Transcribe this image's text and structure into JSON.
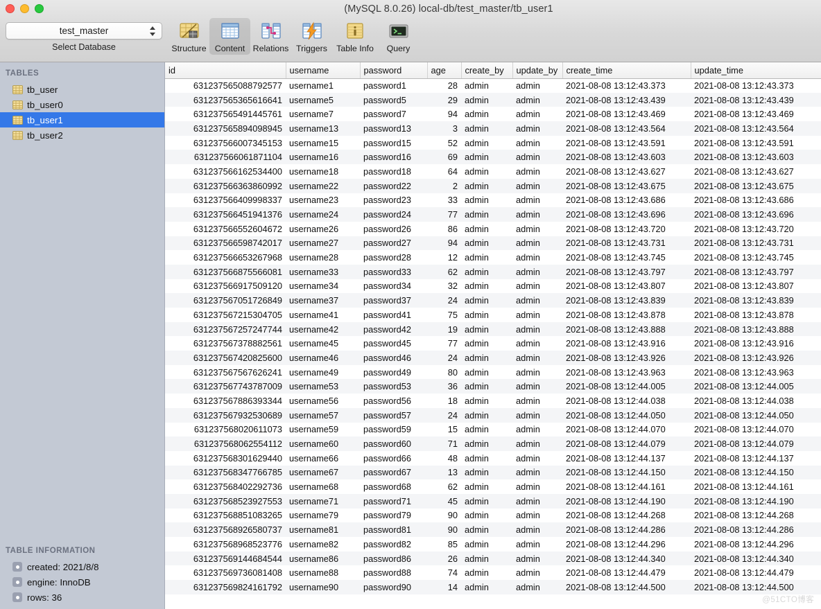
{
  "window": {
    "title": "(MySQL 8.0.26) local-db/test_master/tb_user1",
    "traffic_lights": [
      "close",
      "minimize",
      "zoom"
    ]
  },
  "database_chooser": {
    "selected": "test_master",
    "caption": "Select Database",
    "icon": "chevron-updown-icon"
  },
  "toolbar": {
    "items": [
      {
        "label": "Structure",
        "icon": "structure-icon",
        "active": false
      },
      {
        "label": "Content",
        "icon": "content-icon",
        "active": true
      },
      {
        "label": "Relations",
        "icon": "relations-icon",
        "active": false
      },
      {
        "label": "Triggers",
        "icon": "triggers-icon",
        "active": false
      },
      {
        "label": "Table Info",
        "icon": "table-info-icon",
        "active": false
      },
      {
        "label": "Query",
        "icon": "query-icon",
        "active": false
      }
    ]
  },
  "sidebar": {
    "tables_header": "TABLES",
    "tables": [
      {
        "name": "tb_user",
        "selected": false,
        "icon": "table-icon"
      },
      {
        "name": "tb_user0",
        "selected": false,
        "icon": "table-icon"
      },
      {
        "name": "tb_user1",
        "selected": true,
        "icon": "table-icon"
      },
      {
        "name": "tb_user2",
        "selected": false,
        "icon": "table-icon"
      }
    ],
    "info_header": "TABLE INFORMATION",
    "info": [
      {
        "text": "created: 2021/8/8",
        "icon": "info-bullet-icon"
      },
      {
        "text": "engine: InnoDB",
        "icon": "info-bullet-icon"
      },
      {
        "text": "rows: 36",
        "icon": "info-bullet-icon"
      }
    ],
    "selection_color": "#3478e8",
    "background_color": "#c3c9d4"
  },
  "grid": {
    "columns": [
      "id",
      "username",
      "password",
      "age",
      "create_by",
      "update_by",
      "create_time",
      "update_time"
    ],
    "rows": [
      [
        "631237565088792577",
        "username1",
        "password1",
        "28",
        "admin",
        "admin",
        "2021-08-08 13:12:43.373",
        "2021-08-08 13:12:43.373"
      ],
      [
        "631237565365616641",
        "username5",
        "password5",
        "29",
        "admin",
        "admin",
        "2021-08-08 13:12:43.439",
        "2021-08-08 13:12:43.439"
      ],
      [
        "631237565491445761",
        "username7",
        "password7",
        "94",
        "admin",
        "admin",
        "2021-08-08 13:12:43.469",
        "2021-08-08 13:12:43.469"
      ],
      [
        "631237565894098945",
        "username13",
        "password13",
        "3",
        "admin",
        "admin",
        "2021-08-08 13:12:43.564",
        "2021-08-08 13:12:43.564"
      ],
      [
        "631237566007345153",
        "username15",
        "password15",
        "52",
        "admin",
        "admin",
        "2021-08-08 13:12:43.591",
        "2021-08-08 13:12:43.591"
      ],
      [
        "631237566061871104",
        "username16",
        "password16",
        "69",
        "admin",
        "admin",
        "2021-08-08 13:12:43.603",
        "2021-08-08 13:12:43.603"
      ],
      [
        "631237566162534400",
        "username18",
        "password18",
        "64",
        "admin",
        "admin",
        "2021-08-08 13:12:43.627",
        "2021-08-08 13:12:43.627"
      ],
      [
        "631237566363860992",
        "username22",
        "password22",
        "2",
        "admin",
        "admin",
        "2021-08-08 13:12:43.675",
        "2021-08-08 13:12:43.675"
      ],
      [
        "631237566409998337",
        "username23",
        "password23",
        "33",
        "admin",
        "admin",
        "2021-08-08 13:12:43.686",
        "2021-08-08 13:12:43.686"
      ],
      [
        "631237566451941376",
        "username24",
        "password24",
        "77",
        "admin",
        "admin",
        "2021-08-08 13:12:43.696",
        "2021-08-08 13:12:43.696"
      ],
      [
        "631237566552604672",
        "username26",
        "password26",
        "86",
        "admin",
        "admin",
        "2021-08-08 13:12:43.720",
        "2021-08-08 13:12:43.720"
      ],
      [
        "631237566598742017",
        "username27",
        "password27",
        "94",
        "admin",
        "admin",
        "2021-08-08 13:12:43.731",
        "2021-08-08 13:12:43.731"
      ],
      [
        "631237566653267968",
        "username28",
        "password28",
        "12",
        "admin",
        "admin",
        "2021-08-08 13:12:43.745",
        "2021-08-08 13:12:43.745"
      ],
      [
        "631237566875566081",
        "username33",
        "password33",
        "62",
        "admin",
        "admin",
        "2021-08-08 13:12:43.797",
        "2021-08-08 13:12:43.797"
      ],
      [
        "631237566917509120",
        "username34",
        "password34",
        "32",
        "admin",
        "admin",
        "2021-08-08 13:12:43.807",
        "2021-08-08 13:12:43.807"
      ],
      [
        "631237567051726849",
        "username37",
        "password37",
        "24",
        "admin",
        "admin",
        "2021-08-08 13:12:43.839",
        "2021-08-08 13:12:43.839"
      ],
      [
        "631237567215304705",
        "username41",
        "password41",
        "75",
        "admin",
        "admin",
        "2021-08-08 13:12:43.878",
        "2021-08-08 13:12:43.878"
      ],
      [
        "631237567257247744",
        "username42",
        "password42",
        "19",
        "admin",
        "admin",
        "2021-08-08 13:12:43.888",
        "2021-08-08 13:12:43.888"
      ],
      [
        "631237567378882561",
        "username45",
        "password45",
        "77",
        "admin",
        "admin",
        "2021-08-08 13:12:43.916",
        "2021-08-08 13:12:43.916"
      ],
      [
        "631237567420825600",
        "username46",
        "password46",
        "24",
        "admin",
        "admin",
        "2021-08-08 13:12:43.926",
        "2021-08-08 13:12:43.926"
      ],
      [
        "631237567567626241",
        "username49",
        "password49",
        "80",
        "admin",
        "admin",
        "2021-08-08 13:12:43.963",
        "2021-08-08 13:12:43.963"
      ],
      [
        "631237567743787009",
        "username53",
        "password53",
        "36",
        "admin",
        "admin",
        "2021-08-08 13:12:44.005",
        "2021-08-08 13:12:44.005"
      ],
      [
        "631237567886393344",
        "username56",
        "password56",
        "18",
        "admin",
        "admin",
        "2021-08-08 13:12:44.038",
        "2021-08-08 13:12:44.038"
      ],
      [
        "631237567932530689",
        "username57",
        "password57",
        "24",
        "admin",
        "admin",
        "2021-08-08 13:12:44.050",
        "2021-08-08 13:12:44.050"
      ],
      [
        "631237568020611073",
        "username59",
        "password59",
        "15",
        "admin",
        "admin",
        "2021-08-08 13:12:44.070",
        "2021-08-08 13:12:44.070"
      ],
      [
        "631237568062554112",
        "username60",
        "password60",
        "71",
        "admin",
        "admin",
        "2021-08-08 13:12:44.079",
        "2021-08-08 13:12:44.079"
      ],
      [
        "631237568301629440",
        "username66",
        "password66",
        "48",
        "admin",
        "admin",
        "2021-08-08 13:12:44.137",
        "2021-08-08 13:12:44.137"
      ],
      [
        "631237568347766785",
        "username67",
        "password67",
        "13",
        "admin",
        "admin",
        "2021-08-08 13:12:44.150",
        "2021-08-08 13:12:44.150"
      ],
      [
        "631237568402292736",
        "username68",
        "password68",
        "62",
        "admin",
        "admin",
        "2021-08-08 13:12:44.161",
        "2021-08-08 13:12:44.161"
      ],
      [
        "631237568523927553",
        "username71",
        "password71",
        "45",
        "admin",
        "admin",
        "2021-08-08 13:12:44.190",
        "2021-08-08 13:12:44.190"
      ],
      [
        "631237568851083265",
        "username79",
        "password79",
        "90",
        "admin",
        "admin",
        "2021-08-08 13:12:44.268",
        "2021-08-08 13:12:44.268"
      ],
      [
        "631237568926580737",
        "username81",
        "password81",
        "90",
        "admin",
        "admin",
        "2021-08-08 13:12:44.286",
        "2021-08-08 13:12:44.286"
      ],
      [
        "631237568968523776",
        "username82",
        "password82",
        "85",
        "admin",
        "admin",
        "2021-08-08 13:12:44.296",
        "2021-08-08 13:12:44.296"
      ],
      [
        "631237569144684544",
        "username86",
        "password86",
        "26",
        "admin",
        "admin",
        "2021-08-08 13:12:44.340",
        "2021-08-08 13:12:44.340"
      ],
      [
        "631237569736081408",
        "username88",
        "password88",
        "74",
        "admin",
        "admin",
        "2021-08-08 13:12:44.479",
        "2021-08-08 13:12:44.479"
      ],
      [
        "631237569824161792",
        "username90",
        "password90",
        "14",
        "admin",
        "admin",
        "2021-08-08 13:12:44.500",
        "2021-08-08 13:12:44.500"
      ]
    ]
  },
  "watermark": "@51CTO博客"
}
